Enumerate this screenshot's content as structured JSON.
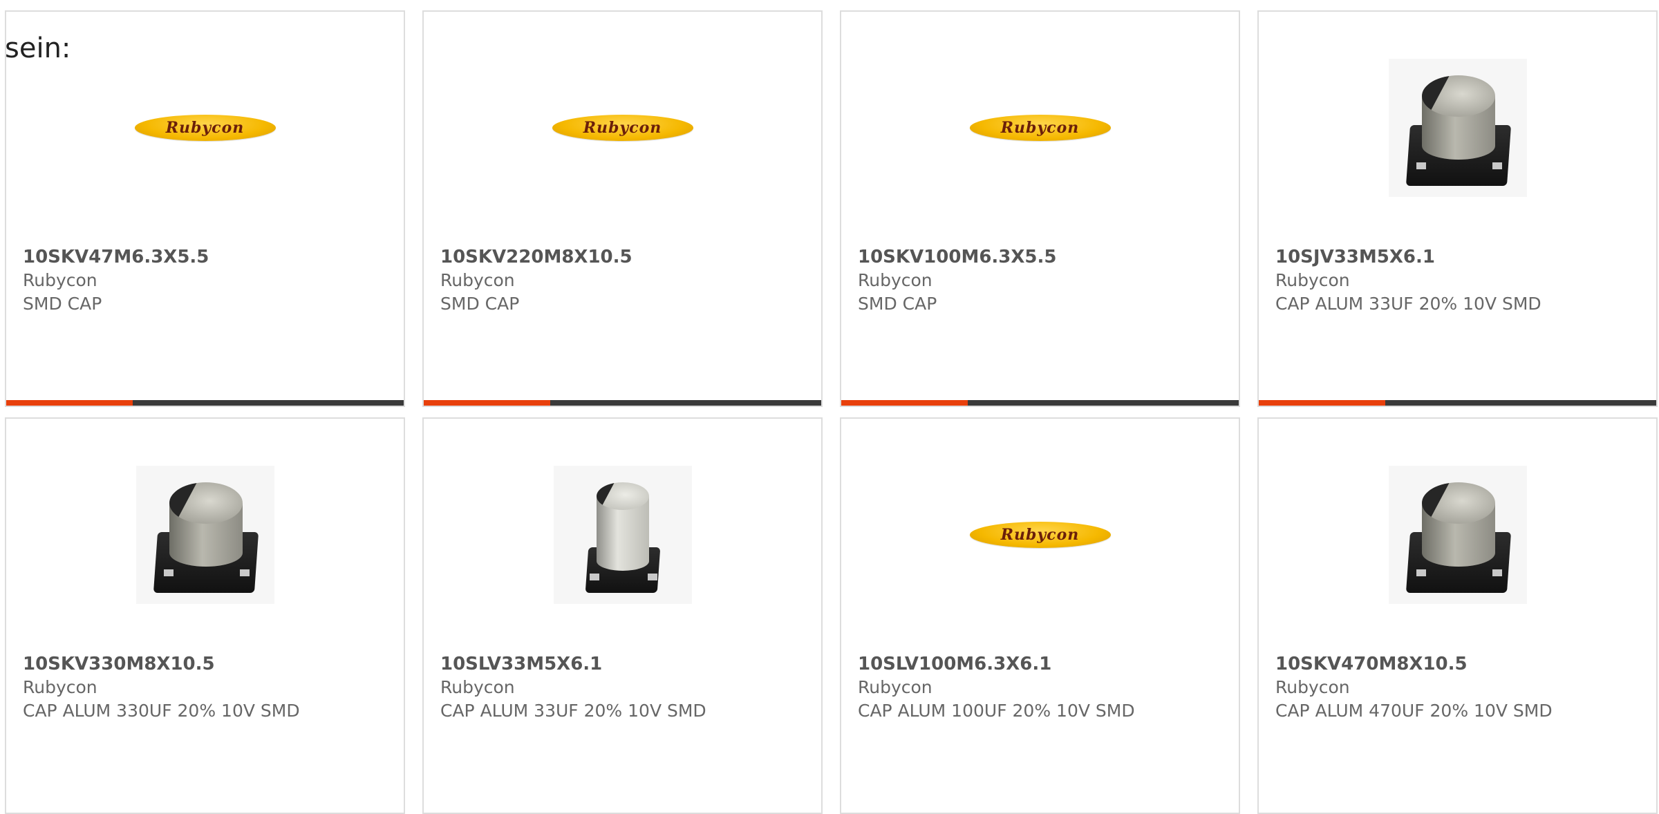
{
  "intro_text": "sein:",
  "colors": {
    "accent": "#e8400c",
    "bar": "#3a3a3a",
    "card_border": "#dddddd",
    "text": "#555555"
  },
  "products": [
    {
      "part_number": "10SKV47M6.3X5.5",
      "manufacturer": "Rubycon",
      "description": "SMD CAP",
      "image": "rubycon-logo",
      "logo_text": "Rubycon"
    },
    {
      "part_number": "10SKV220M8X10.5",
      "manufacturer": "Rubycon",
      "description": "SMD CAP",
      "image": "rubycon-logo",
      "logo_text": "Rubycon"
    },
    {
      "part_number": "10SKV100M6.3X5.5",
      "manufacturer": "Rubycon",
      "description": "SMD CAP",
      "image": "rubycon-logo",
      "logo_text": "Rubycon"
    },
    {
      "part_number": "10SJV33M5X6.1",
      "manufacturer": "Rubycon",
      "description": "CAP ALUM 33UF 20% 10V SMD",
      "image": "smd-capacitor-photo"
    },
    {
      "part_number": "10SKV330M8X10.5",
      "manufacturer": "Rubycon",
      "description": "CAP ALUM 330UF 20% 10V SMD",
      "image": "smd-capacitor-photo"
    },
    {
      "part_number": "10SLV33M5X6.1",
      "manufacturer": "Rubycon",
      "description": "CAP ALUM 33UF 20% 10V SMD",
      "image": "smd-capacitor-tall-photo"
    },
    {
      "part_number": "10SLV100M6.3X6.1",
      "manufacturer": "Rubycon",
      "description": "CAP ALUM 100UF 20% 10V SMD",
      "image": "rubycon-logo",
      "logo_text": "Rubycon"
    },
    {
      "part_number": "10SKV470M8X10.5",
      "manufacturer": "Rubycon",
      "description": "CAP ALUM 470UF 20% 10V SMD",
      "image": "smd-capacitor-photo"
    }
  ]
}
